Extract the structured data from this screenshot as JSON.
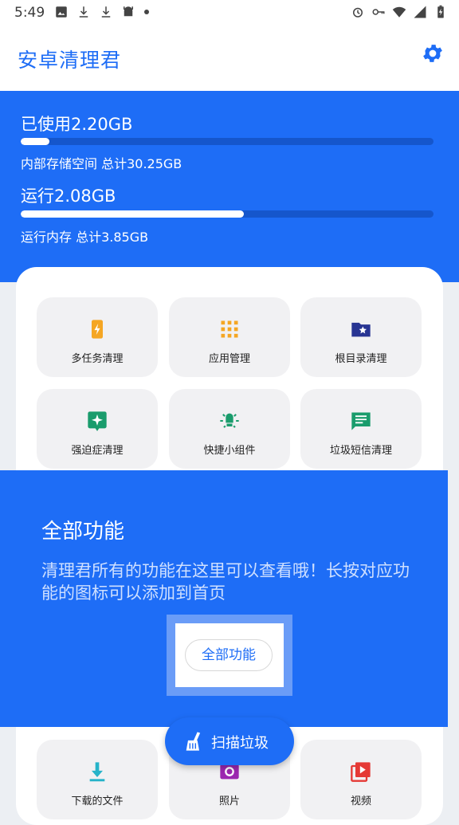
{
  "status_bar": {
    "time": "5:49",
    "left_icons": [
      "image-icon",
      "download-icon",
      "download-icon",
      "android-icon",
      "dot-icon"
    ],
    "right_icons": [
      "alarm-icon",
      "vpn-key-icon",
      "wifi-icon",
      "signal-icon",
      "battery-charging-icon"
    ]
  },
  "app_bar": {
    "title": "安卓清理君",
    "settings_icon": "gear-icon"
  },
  "storage": {
    "used_label": "已使用2.20GB",
    "detail": "内部存储空间 总计30.25GB",
    "percent": 7
  },
  "memory": {
    "used_label": "运行2.08GB",
    "detail": "运行内存 总计3.85GB",
    "percent": 54
  },
  "tiles": [
    {
      "label": "多任务清理",
      "icon": "phone-bolt-icon",
      "color": "#f5a623"
    },
    {
      "label": "应用管理",
      "icon": "grid-icon",
      "color": "#f5a623"
    },
    {
      "label": "根目录清理",
      "icon": "folder-star-icon",
      "color": "#283593"
    },
    {
      "label": "强迫症清理",
      "icon": "sparkle-icon",
      "color": "#1a9c6c"
    },
    {
      "label": "快捷小组件",
      "icon": "bulb-icon",
      "color": "#1a9c6c"
    },
    {
      "label": "垃圾短信清理",
      "icon": "message-icon",
      "color": "#1a9c6c"
    },
    {
      "label": "下载的文件",
      "icon": "download-tile-icon",
      "color": "#26b3c9"
    },
    {
      "label": "照片",
      "icon": "photo-icon",
      "color": "#9c27b0"
    },
    {
      "label": "视频",
      "icon": "video-library-icon",
      "color": "#e53935"
    }
  ],
  "guide": {
    "title": "全部功能",
    "description": "清理君所有的功能在这里可以查看哦！长按对应功能的图标可以添加到首页",
    "button": "全部功能"
  },
  "fab": {
    "label": "扫描垃圾",
    "icon": "broom-icon"
  },
  "colors": {
    "primary": "#1e6df6",
    "tile_bg": "#f1f1f3"
  }
}
